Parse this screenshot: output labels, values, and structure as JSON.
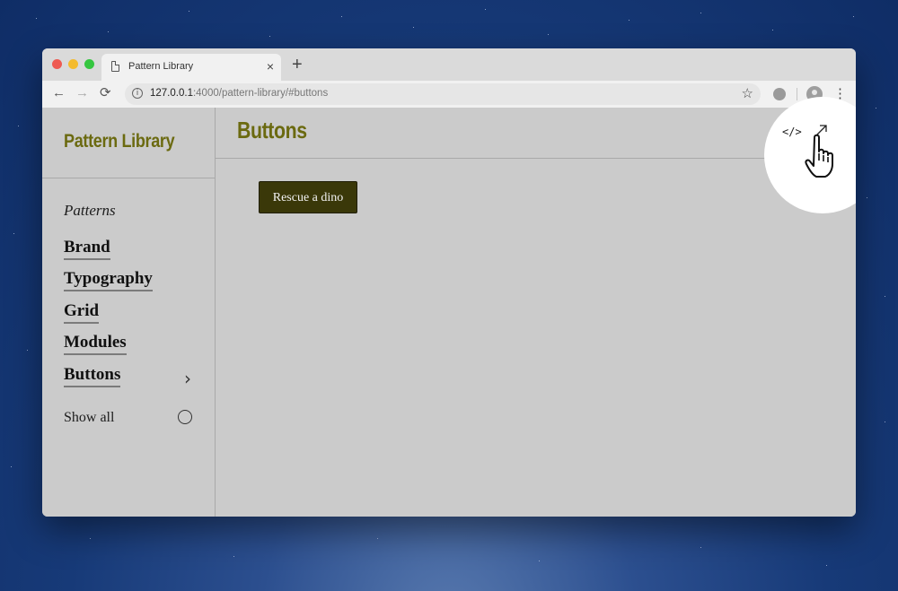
{
  "browser": {
    "tab_title": "Pattern Library",
    "tab_close": "×",
    "new_tab": "+",
    "url_host": "127.0.0.1",
    "url_path": ":4000/pattern-library/#buttons",
    "back_glyph": "←",
    "forward_glyph": "→",
    "reload_glyph": "⟳",
    "star_glyph": "☆",
    "menu_glyph": "⋮",
    "info_glyph": "i"
  },
  "sidebar": {
    "title": "Pattern Library",
    "section_label": "Patterns",
    "items": [
      {
        "label": "Brand"
      },
      {
        "label": "Typography"
      },
      {
        "label": "Grid"
      },
      {
        "label": "Modules"
      },
      {
        "label": "Buttons",
        "active": true
      }
    ],
    "active_chevron": "›",
    "show_all_label": "Show all"
  },
  "main": {
    "title": "Buttons",
    "code_icon": "</>",
    "demo_button_label": "Rescue a dino"
  },
  "colors": {
    "brand_olive": "#6b6a10",
    "button_bg": "#3a3809",
    "panel_gray": "#cbcbcb"
  }
}
